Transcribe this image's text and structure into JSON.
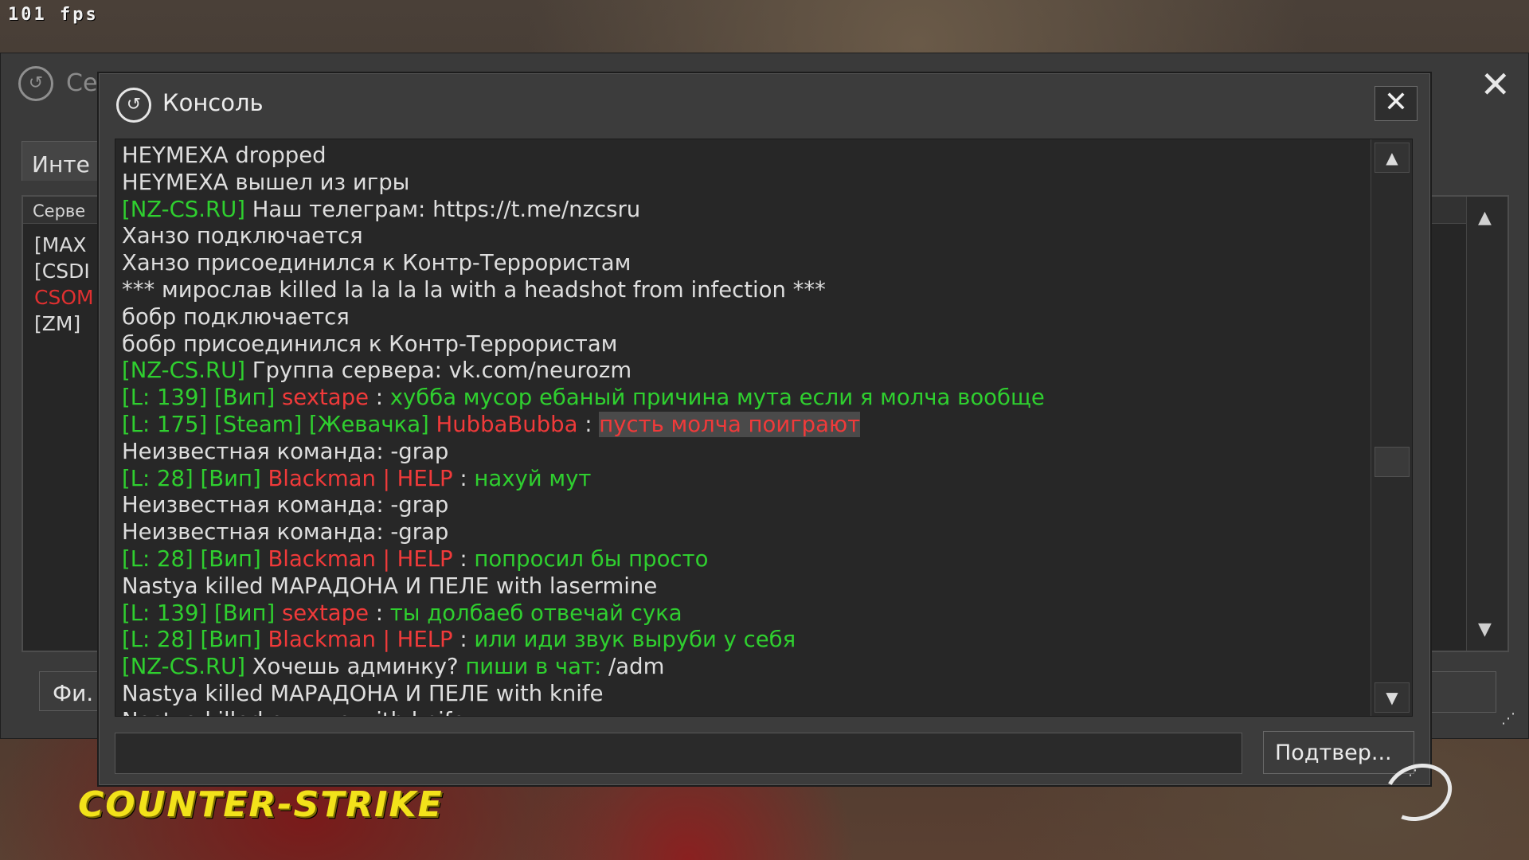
{
  "hud": {
    "fps": "101 fps"
  },
  "server_browser": {
    "title": "Се",
    "tab": "Инте",
    "list_header": "Серве",
    "servers": [
      {
        "name": "[MAX",
        "color": "#dcdcdc"
      },
      {
        "name": "[CSDI",
        "color": "#dcdcdc"
      },
      {
        "name": "CSOM",
        "color": "#e03030"
      },
      {
        "name": "[ZM]",
        "color": "#dcdcdc"
      }
    ],
    "filter_button": "Фи."
  },
  "console": {
    "title": "Консоль",
    "input_value": "",
    "submit_label": "Подтвер...",
    "lines": [
      [
        {
          "t": "HEYMEXA dropped",
          "c": "default"
        }
      ],
      [
        {
          "t": "HEYMEXA вышел из игры",
          "c": "default"
        }
      ],
      [
        {
          "t": "[NZ-CS.RU] ",
          "c": "green"
        },
        {
          "t": "Наш телеграм: https://t.me/nzcsru",
          "c": "default"
        }
      ],
      [
        {
          "t": "Ханзо подключается",
          "c": "default"
        }
      ],
      [
        {
          "t": "Ханзо присоединился к Контр-Террористам",
          "c": "default"
        }
      ],
      [
        {
          "t": "*** мирослав killed la la la la with a headshot from infection ***",
          "c": "default"
        }
      ],
      [
        {
          "t": "бобр подключается",
          "c": "default"
        }
      ],
      [
        {
          "t": "бобр присоединился к Контр-Террористам",
          "c": "default"
        }
      ],
      [
        {
          "t": "[NZ-CS.RU] ",
          "c": "green"
        },
        {
          "t": "Группа сервера: vk.com/neurozm",
          "c": "default"
        }
      ],
      [
        {
          "t": "[L: 139] [Вип] ",
          "c": "green"
        },
        {
          "t": "sextape",
          "c": "red"
        },
        {
          "t": " : ",
          "c": "default"
        },
        {
          "t": "хубба мусор ебаный причина мута если я молча вообще",
          "c": "green"
        }
      ],
      [
        {
          "t": "[L: 175] [Steam] [Жевачка] ",
          "c": "green"
        },
        {
          "t": "HubbaBubba",
          "c": "red"
        },
        {
          "t": " : ",
          "c": "default"
        },
        {
          "t": "пусть молча поиграют",
          "c": "hl"
        }
      ],
      [
        {
          "t": "Неизвестная команда: -grap",
          "c": "default"
        }
      ],
      [
        {
          "t": "[L: 28] [Вип] ",
          "c": "green"
        },
        {
          "t": "Blackman | HELP",
          "c": "red"
        },
        {
          "t": " : ",
          "c": "default"
        },
        {
          "t": "нахуй мут",
          "c": "green"
        }
      ],
      [
        {
          "t": "Неизвестная команда: -grap",
          "c": "default"
        }
      ],
      [
        {
          "t": "Неизвестная команда: -grap",
          "c": "default"
        }
      ],
      [
        {
          "t": "[L: 28] [Вип] ",
          "c": "green"
        },
        {
          "t": "Blackman | HELP",
          "c": "red"
        },
        {
          "t": " : ",
          "c": "default"
        },
        {
          "t": "попросил бы просто",
          "c": "green"
        }
      ],
      [
        {
          "t": "Nastya killed МАРАДОНА И ПЕЛЕ with lasermine",
          "c": "default"
        }
      ],
      [
        {
          "t": "[L: 139] [Вип] ",
          "c": "green"
        },
        {
          "t": "sextape",
          "c": "red"
        },
        {
          "t": " : ",
          "c": "default"
        },
        {
          "t": "ты долбаеб отвечай сука",
          "c": "green"
        }
      ],
      [
        {
          "t": "[L: 28] [Вип] ",
          "c": "green"
        },
        {
          "t": "Blackman | HELP",
          "c": "red"
        },
        {
          "t": " : ",
          "c": "default"
        },
        {
          "t": "или иди звук выруби у себя",
          "c": "green"
        }
      ],
      [
        {
          "t": "[NZ-CS.RU] ",
          "c": "green"
        },
        {
          "t": "Хочешь админку? ",
          "c": "default"
        },
        {
          "t": "пиши в чат: ",
          "c": "green"
        },
        {
          "t": "/adm",
          "c": "default"
        }
      ],
      [
        {
          "t": "Nastya killed МАРАДОНА И ПЕЛЕ with knife",
          "c": "default"
        }
      ],
      [
        {
          "t": "Nastya killed оливье with knife",
          "c": "default"
        }
      ]
    ]
  },
  "branding": {
    "logo_text": "COUNTER-STRIKE"
  },
  "colors": {
    "green": "#2fcf2f",
    "red": "#f03a3a",
    "text": "#dedede",
    "logo": "#f2e21a"
  },
  "icons": {
    "console_icon": "cs-emblem-icon",
    "close": "close-icon",
    "scroll_up": "arrow-up-icon",
    "scroll_down": "arrow-down-icon",
    "resize": "resize-grip-icon"
  }
}
